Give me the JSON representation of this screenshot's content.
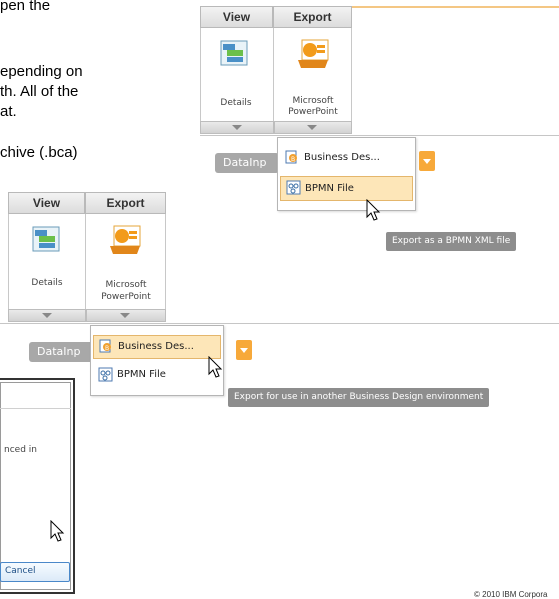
{
  "slide": {
    "lines": [
      "pen the",
      "epending on",
      "th. All of the",
      "at.",
      "chive (.bca)"
    ]
  },
  "ribbon_top": {
    "tabs": [
      "View",
      "Export"
    ],
    "details_label": "Details",
    "ppt_label_1": "Microsoft",
    "ppt_label_2": "PowerPoint",
    "datainput": "DataInp",
    "menu": [
      "Business Des...",
      "BPMN File"
    ],
    "highlighted_index": 1,
    "tooltip": "Export as a BPMN XML file"
  },
  "ribbon_bottom": {
    "tabs": [
      "View",
      "Export"
    ],
    "details_label": "Details",
    "ppt_label_1": "Microsoft",
    "ppt_label_2": "PowerPoint",
    "datainput": "DataInp",
    "menu": [
      "Business Des...",
      "BPMN File"
    ],
    "highlighted_index": 0,
    "tooltip": "Export for use in another Business Design environment"
  },
  "dialog": {
    "text": "nced in",
    "cancel_label": "Cancel"
  },
  "copyright": "© 2010 IBM Corpora",
  "colors": {
    "accent_orange": "#f7a93a",
    "highlight": "#fde6b8",
    "tooltip": "#8d8d8d"
  }
}
